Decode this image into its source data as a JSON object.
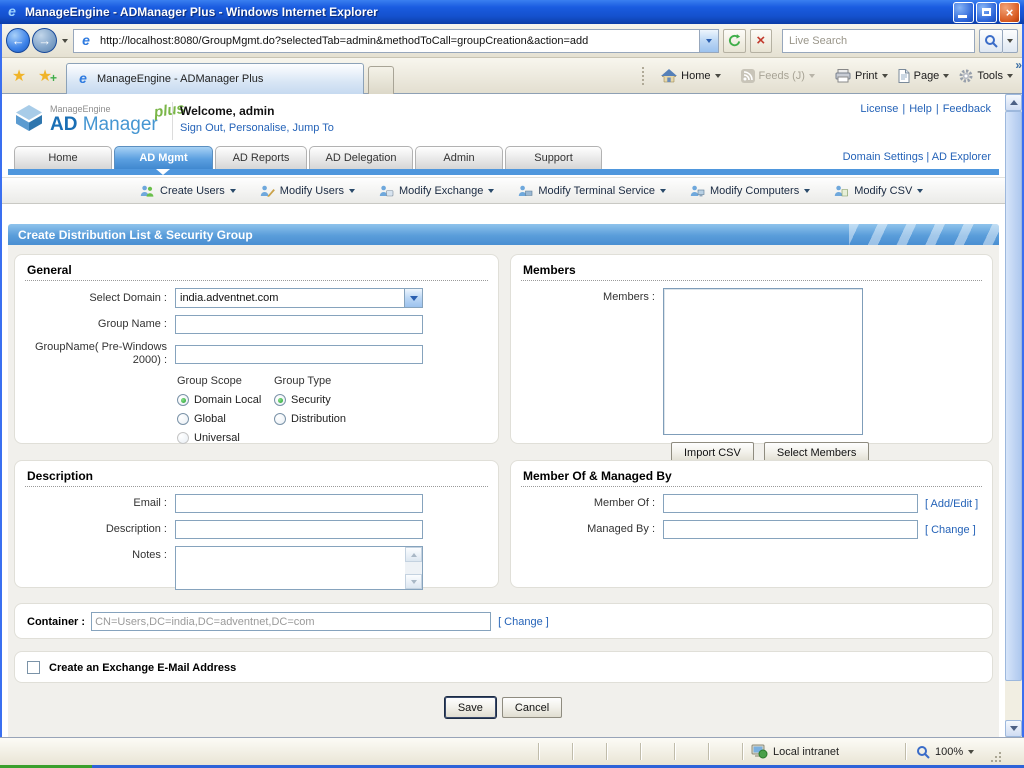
{
  "window": {
    "title": "ManageEngine - ADManager Plus - Windows Internet Explorer",
    "url": "http://localhost:8080/GroupMgmt.do?selectedTab=admin&methodToCall=groupCreation&action=add",
    "search_placeholder": "Live Search",
    "tab_title": "ManageEngine - ADManager Plus",
    "toolbar_home": "Home",
    "toolbar_feeds": "Feeds (J)",
    "toolbar_print": "Print",
    "toolbar_page": "Page",
    "toolbar_tools": "Tools",
    "toolbar_more": "»",
    "status_zone": "Local intranet",
    "status_zoom": "100%"
  },
  "header": {
    "brand_small": "ManageEngine",
    "brand_ad": "AD",
    "brand_manager": "Manager",
    "brand_plus": "plus",
    "welcome": "Welcome, admin",
    "session_links": "Sign Out, Personalise, Jump To",
    "license": "License",
    "help": "Help",
    "feedback": "Feedback",
    "sep": "|",
    "domain_settings": "Domain Settings",
    "ad_explorer": "AD Explorer"
  },
  "nav": {
    "tabs": [
      {
        "label": "Home",
        "active": false
      },
      {
        "label": "AD Mgmt",
        "active": true
      },
      {
        "label": "AD Reports",
        "active": false
      },
      {
        "label": "AD Delegation",
        "active": false
      },
      {
        "label": "Admin",
        "active": false
      },
      {
        "label": "Support",
        "active": false
      }
    ],
    "menu": [
      {
        "label": "Create Users"
      },
      {
        "label": "Modify Users"
      },
      {
        "label": "Modify Exchange"
      },
      {
        "label": "Modify Terminal Service"
      },
      {
        "label": "Modify Computers"
      },
      {
        "label": "Modify CSV"
      }
    ]
  },
  "page": {
    "title": "Create Distribution List & Security Group"
  },
  "general": {
    "title": "General",
    "domain_label": "Select Domain :",
    "domain_value": "india.adventnet.com",
    "group_name_label": "Group Name :",
    "pre2000_label": "GroupName( Pre-Windows 2000) :",
    "scope_label": "Group Scope",
    "scope_options": [
      {
        "label": "Domain Local",
        "selected": true,
        "disabled": false
      },
      {
        "label": "Global",
        "selected": false,
        "disabled": false
      },
      {
        "label": "Universal",
        "selected": false,
        "disabled": true
      }
    ],
    "type_label": "Group Type",
    "type_options": [
      {
        "label": "Security",
        "selected": true,
        "disabled": false
      },
      {
        "label": "Distribution",
        "selected": false,
        "disabled": false
      }
    ]
  },
  "members": {
    "title": "Members",
    "label": "Members :",
    "import_csv": "Import CSV",
    "select_members": "Select Members"
  },
  "description": {
    "title": "Description",
    "email_label": "Email :",
    "description_label": "Description :",
    "notes_label": "Notes :"
  },
  "member_of": {
    "title": "Member Of & Managed By",
    "member_of_label": "Member Of :",
    "add_edit": "[ Add/Edit ]",
    "managed_by_label": "Managed By :",
    "change": "[ Change ]"
  },
  "container": {
    "label": "Container :",
    "value": "CN=Users,DC=india,DC=adventnet,DC=com",
    "change": "[ Change ]"
  },
  "footer": {
    "exchange_label": "Create an Exchange E-Mail Address",
    "save": "Save",
    "cancel": "Cancel"
  },
  "colors": {
    "accent_blue": "#4f97dd",
    "link_blue": "#2563b8",
    "titlebar_blue": "#1450cc",
    "radio_green": "#1f9e2f",
    "plus_green": "#7ab648"
  }
}
